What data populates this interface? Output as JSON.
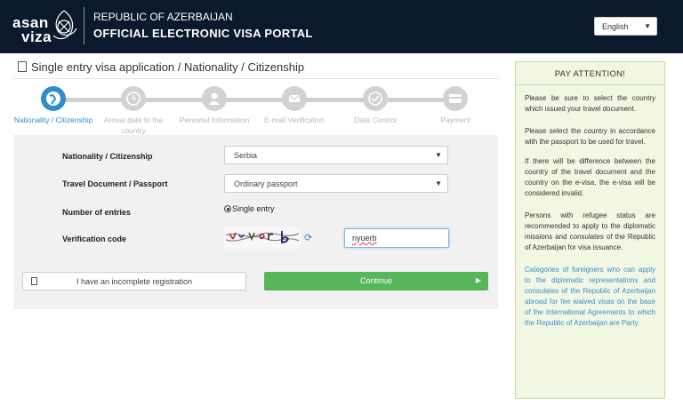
{
  "header": {
    "logo_line1": "asan",
    "logo_line2": "viza",
    "subtitle": "REPUBLIC OF AZERBAIJAN",
    "title": "OFFICIAL ELECTRONIC VISA PORTAL",
    "language": "English",
    "colors": {
      "background": "#0a1a2c"
    }
  },
  "page": {
    "title": "Single entry visa application / Nationality / Citizenship"
  },
  "steps": [
    {
      "label": "Nationality / Citizenship",
      "icon": "globe-icon",
      "active": true
    },
    {
      "label": "Arrival date to the country",
      "icon": "clock-icon",
      "active": false
    },
    {
      "label": "Personal Information",
      "icon": "user-icon",
      "active": false
    },
    {
      "label": "E-mail Verification",
      "icon": "envelope-icon",
      "active": false
    },
    {
      "label": "Data Control",
      "icon": "check-icon",
      "active": false
    },
    {
      "label": "Payment",
      "icon": "card-icon",
      "active": false
    }
  ],
  "form": {
    "nationality_label": "Nationality / Citizenship",
    "nationality_value": "Serbia",
    "document_label": "Travel Document / Passport",
    "document_value": "Ordinary passport",
    "entries_label": "Number of entries",
    "entries_value": "Single entry",
    "verification_label": "Verification code",
    "verification_value": "nyuerb",
    "incomplete_button": "I have an incomplete registration",
    "continue_button": "Continue",
    "colors": {
      "accent": "#2f8dcd",
      "continue": "#56b65a"
    }
  },
  "attention": {
    "heading": "PAY ATTENTION!",
    "p1": "Please be sure to select the country which issued your travel document.",
    "p2": "Please select the country in accordance with the passport to be used for travel.",
    "p3": "If there will be difference between the country of the travel document and the country on the e-visa, the e-visa will be considered invalid.",
    "p4": "Persons with refugee status are recommended to apply to the diplomatic missions and consulates of the Republic of Azerbaijan for visa issuance.",
    "p5": "Categories of foreigners who can apply to the diplomatic representations and consulates of the Republic of Azerbaijan abroad for fee waived visas on the base of the International Agreements to which the Republic of Azerbaijan are Party."
  }
}
